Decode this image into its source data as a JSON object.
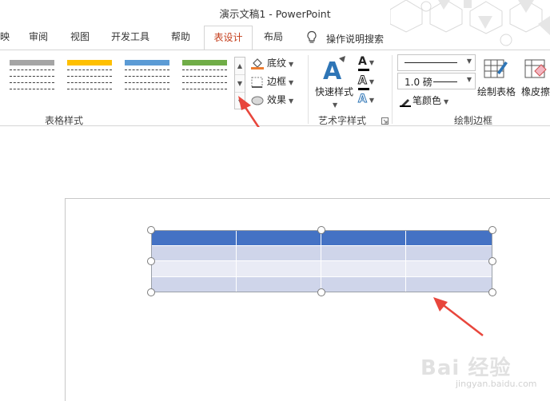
{
  "window": {
    "title": "演示文稿1  -  PowerPoint"
  },
  "tabs": [
    {
      "label": "映",
      "active": false
    },
    {
      "label": "审阅",
      "active": false
    },
    {
      "label": "视图",
      "active": false
    },
    {
      "label": "开发工具",
      "active": false
    },
    {
      "label": "帮助",
      "active": false
    },
    {
      "label": "表设计",
      "active": true
    },
    {
      "label": "布局",
      "active": false
    }
  ],
  "tell_me": {
    "label": "操作说明搜索",
    "icon": "lightbulb-icon"
  },
  "ribbon": {
    "table_styles": {
      "group_label": "表格样式",
      "gallery_colors": [
        "#a5a5a5",
        "#ffc000",
        "#5b9bd5",
        "#70ad47"
      ],
      "shading_label": "底纹",
      "borders_label": "边框",
      "effects_label": "效果"
    },
    "wordart": {
      "group_label": "艺术字样式",
      "quick_styles_label": "快速样式"
    },
    "draw_borders": {
      "group_label": "绘制边框",
      "line_weight": "1.0 磅",
      "pen_color_label": "笔颜色",
      "draw_table_label": "绘制表格",
      "eraser_label": "橡皮擦"
    }
  },
  "table": {
    "header_color": "#4472c4",
    "band_dark": "#cfd5ea",
    "band_light": "#e9ebf5",
    "columns": 4,
    "rows": 4
  },
  "watermark": {
    "text": "Bai 经验",
    "sub": "jingyan.baidu.com"
  },
  "colors": {
    "arrow": "#e8463c",
    "active_tab_text": "#c43e1c"
  }
}
